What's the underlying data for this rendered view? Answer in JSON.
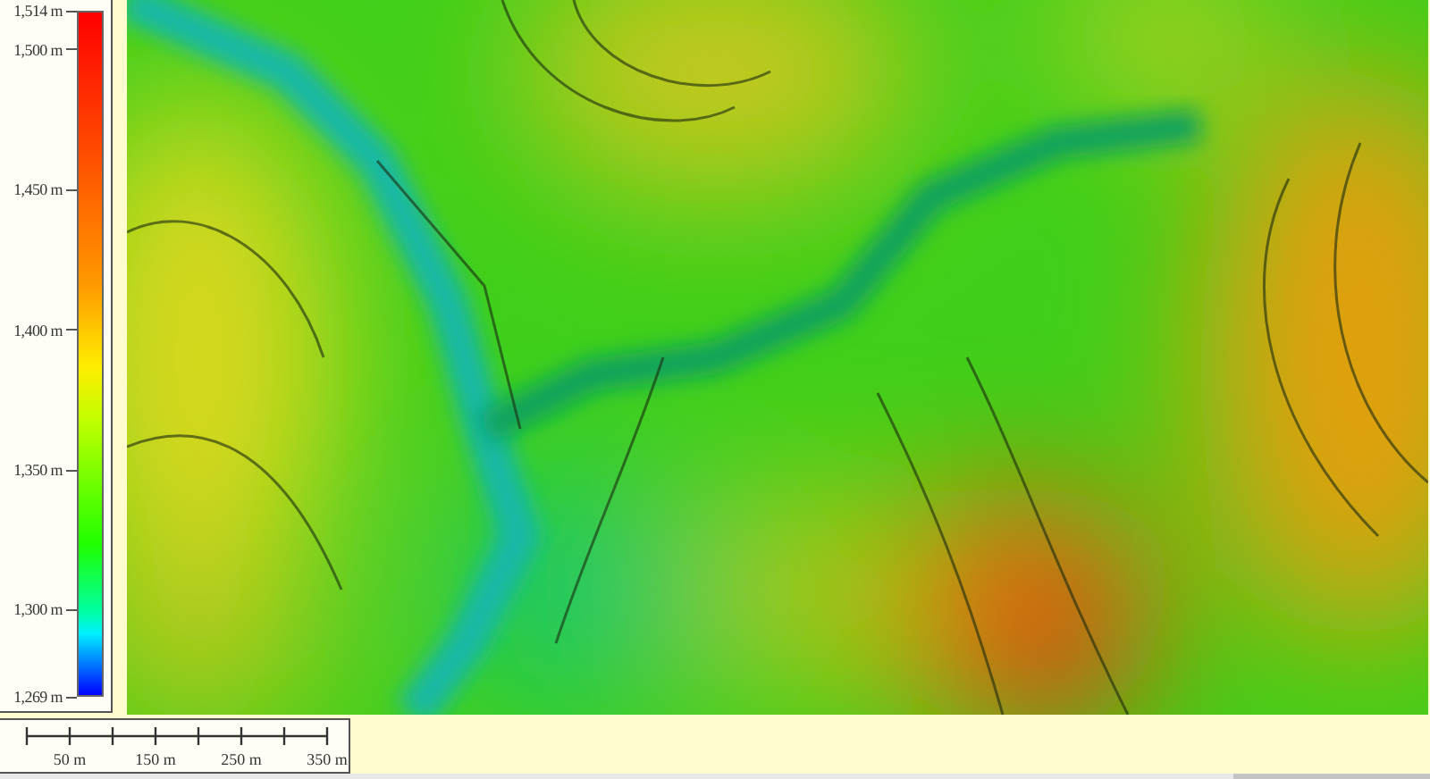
{
  "legend": {
    "labels": [
      "1,514 m",
      "1,500 m",
      "1,450 m",
      "1,400 m",
      "1,350 m",
      "1,300 m",
      "1,269 m"
    ]
  },
  "scale_bar": {
    "labels": [
      "50 m",
      "150 m",
      "250 m",
      "350 m"
    ]
  }
}
